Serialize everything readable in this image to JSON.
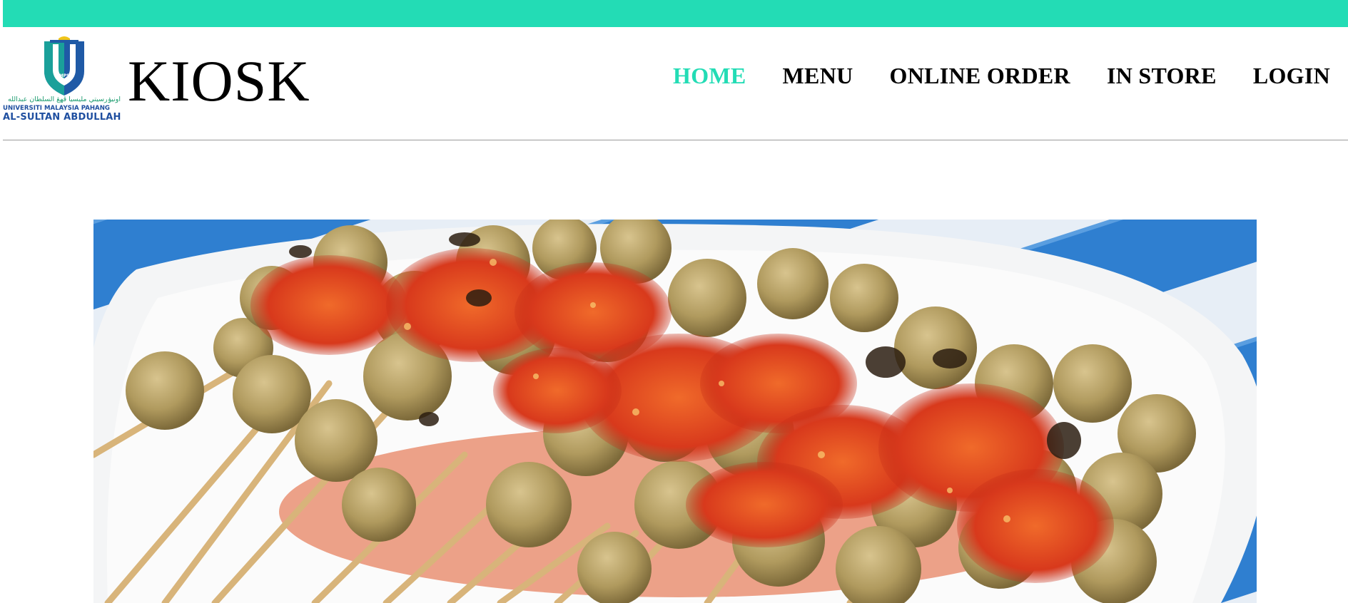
{
  "colors": {
    "accent": "#23dcb5",
    "nav_text": "#000000",
    "divider": "#9a9a9a",
    "logo_blue": "#1f5aa6",
    "logo_green": "#1aa09a",
    "logo_yellow": "#f0c419",
    "logo_text_green": "#1a9b6e",
    "logo_text_blue": "#1f4fa0"
  },
  "header": {
    "logo": {
      "icon": "university-crest-icon",
      "arabic_text": "اونيۏرسيتي مليسيا ڤهڠ السلطان عبدالله",
      "line1": "UNIVERSITI MALAYSIA PAHANG",
      "line2": "AL-SULTAN ABDULLAH",
      "shield_text": "UMPSA"
    },
    "brand_name": "KIOSK"
  },
  "nav": {
    "items": [
      {
        "label": "HOME",
        "active": true
      },
      {
        "label": "MENU",
        "active": false
      },
      {
        "label": "ONLINE ORDER",
        "active": false
      },
      {
        "label": "IN STORE",
        "active": false
      },
      {
        "label": "LOGIN",
        "active": false
      }
    ]
  },
  "hero": {
    "image": "grilled-fishball-skewers-with-chili-sauce-photo"
  }
}
